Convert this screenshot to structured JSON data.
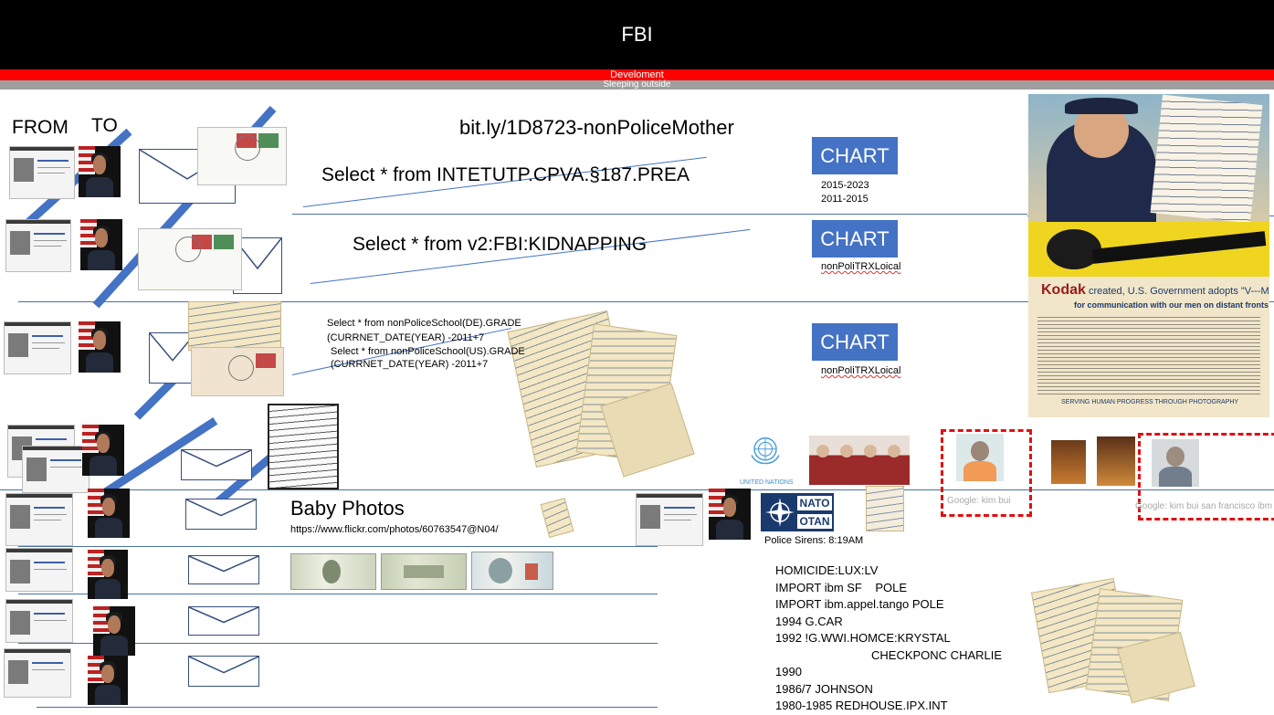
{
  "header": {
    "title": "FBI"
  },
  "banners": {
    "red_text": "Develoment",
    "gray_text": "Sleeping outside"
  },
  "columns": {
    "from": "FROM",
    "to": "TO"
  },
  "link_top": "bit.ly/1D8723-nonPoliceMother",
  "queries": {
    "q1": "Select * from INTETUTP.CPVA.§187.PREA",
    "q2": "Select * from v2:FBI:KIDNAPPING",
    "q3a": "Select * from nonPoliceSchool(DE).GRADE",
    "q3b": "(CURRNET_DATE(YEAR) -2011+7",
    "q4a": "Select * from nonPoliceSchool(US).GRADE",
    "q4b": "(CURRNET_DATE(YEAR) -2011+7"
  },
  "charts": [
    {
      "label": "CHART",
      "notes": [
        "2015-2023",
        "2011-2015"
      ]
    },
    {
      "label": "CHART",
      "notes": [
        "nonPoliTRXLoical"
      ]
    },
    {
      "label": "CHART",
      "notes": [
        "nonPoliTRXLoical"
      ]
    }
  ],
  "baby": {
    "title": "Baby Photos",
    "url": "https://www.flickr.com/photos/60763547@N04/"
  },
  "logos": {
    "un": "UNITED NATIONS",
    "nato1": "NATO",
    "nato2": "OTAN"
  },
  "police_sirens": "Police Sirens: 8:19AM",
  "google": {
    "g1": "Google: kim bui",
    "g2": "Google: kim bui san francisco ibm"
  },
  "notes": [
    "HOMICIDE:LUX:LV",
    "IMPORT ibm SF    POLE",
    "IMPORT ibm.appel.tango POLE",
    "1994 G.CAR",
    "1992 !G.WWI.HOMCE:KRYSTAL",
    "CHECKPONC CHARLIE",
    "1990",
    "1986/7 JOHNSON",
    "1980-1985 REDHOUSE.IPX.INT"
  ],
  "poster": {
    "headline_brand": "Kodak",
    "headline_rest": "created, U.S. Government adopts \"V---MAIL\"...",
    "subhead": "for communication with our men on distant fronts",
    "footer": "SERVING HUMAN PROGRESS THROUGH PHOTOGRAPHY"
  },
  "colors": {
    "accent": "#4472c4",
    "banner_red": "#ff0000",
    "banner_gray": "#9e9e9e"
  }
}
